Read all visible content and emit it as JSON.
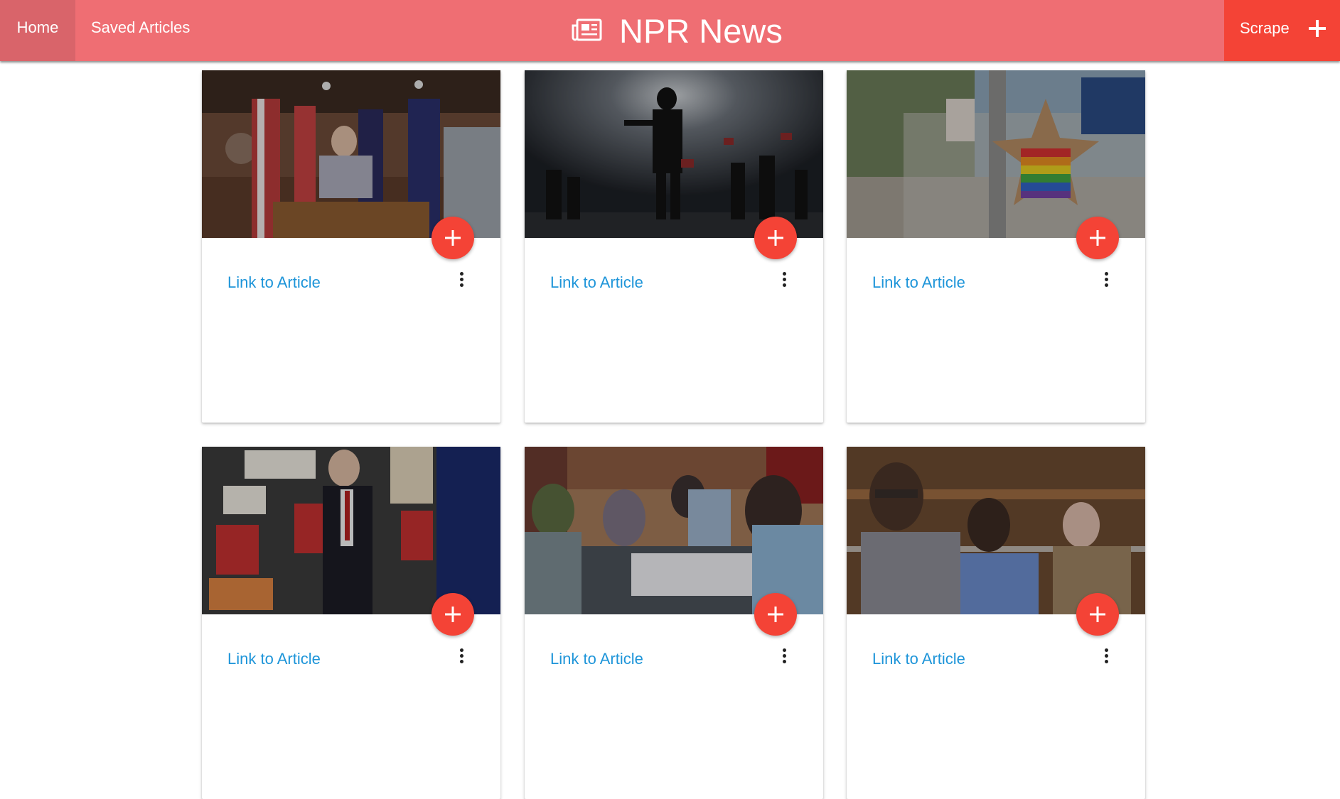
{
  "navbar": {
    "home_label": "Home",
    "saved_label": "Saved Articles",
    "brand_title": "NPR News",
    "brand_icon": "newspaper-icon",
    "scrape_label": "Scrape",
    "scrape_icon": "plus-icon"
  },
  "colors": {
    "navbar": "#ef6e73",
    "accent": "#f44336",
    "link": "#1e95d9"
  },
  "articles": [
    {
      "link_label": "Link to Article",
      "image": "press-conference-photo",
      "add_icon": "plus-icon",
      "menu_icon": "more-vert-icon"
    },
    {
      "link_label": "Link to Article",
      "image": "silhouette-protest-photo",
      "add_icon": "plus-icon",
      "menu_icon": "more-vert-icon"
    },
    {
      "link_label": "Link to Article",
      "image": "memorial-fence-photo",
      "add_icon": "plus-icon",
      "menu_icon": "more-vert-icon"
    },
    {
      "link_label": "Link to Article",
      "image": "museum-exhibit-photo",
      "add_icon": "plus-icon",
      "menu_icon": "more-vert-icon"
    },
    {
      "link_label": "Link to Article",
      "image": "ballot-count-photo",
      "add_icon": "plus-icon",
      "menu_icon": "more-vert-icon"
    },
    {
      "link_label": "Link to Article",
      "image": "courtroom-photo",
      "add_icon": "plus-icon",
      "menu_icon": "more-vert-icon"
    }
  ]
}
